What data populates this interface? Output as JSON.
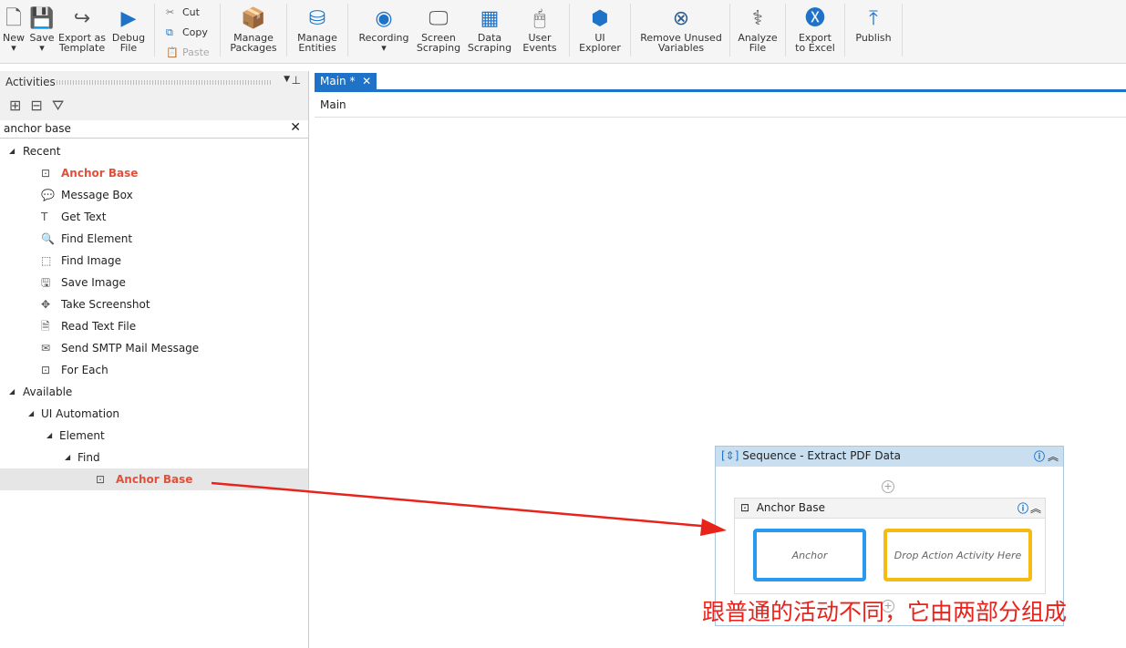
{
  "toolbar": {
    "new": "New",
    "save": "Save",
    "export_template": "Export as Template",
    "debug": "Debug File",
    "cut": "Cut",
    "copy": "Copy",
    "paste": "Paste",
    "manage_packages": "Manage Packages",
    "manage_entities": "Manage Entities",
    "recording": "Recording",
    "screen_scraping": "Screen Scraping",
    "data_scraping": "Data Scraping",
    "user_events": "User Events",
    "ui_explorer": "UI Explorer",
    "remove_unused": "Remove Unused Variables",
    "analyze": "Analyze File",
    "export_excel": "Export to Excel",
    "publish": "Publish"
  },
  "activities": {
    "title": "Activities",
    "search_value": "anchor base",
    "recent_label": "Recent",
    "recent": [
      "Anchor Base",
      "Message Box",
      "Get Text",
      "Find Element",
      "Find Image",
      "Save Image",
      "Take Screenshot",
      "Read Text File",
      "Send SMTP Mail Message",
      "For Each"
    ],
    "available_label": "Available",
    "ui_automation": "UI Automation",
    "element": "Element",
    "find": "Find",
    "result": "Anchor Base"
  },
  "designer": {
    "tab": "Main *",
    "breadcrumb": "Main",
    "sequence_title": "Sequence - Extract PDF Data",
    "anchor_base_title": "Anchor Base",
    "anchor_slot": "Anchor",
    "action_slot": "Drop Action Activity Here"
  },
  "annotation": "跟普通的活动不同，它由两部分组成",
  "colors": {
    "accent": "#1e73c8",
    "highlight": "#e0503a",
    "anchor_border": "#2a9af0",
    "action_border": "#f5bb12",
    "arrow": "#e8231b"
  }
}
